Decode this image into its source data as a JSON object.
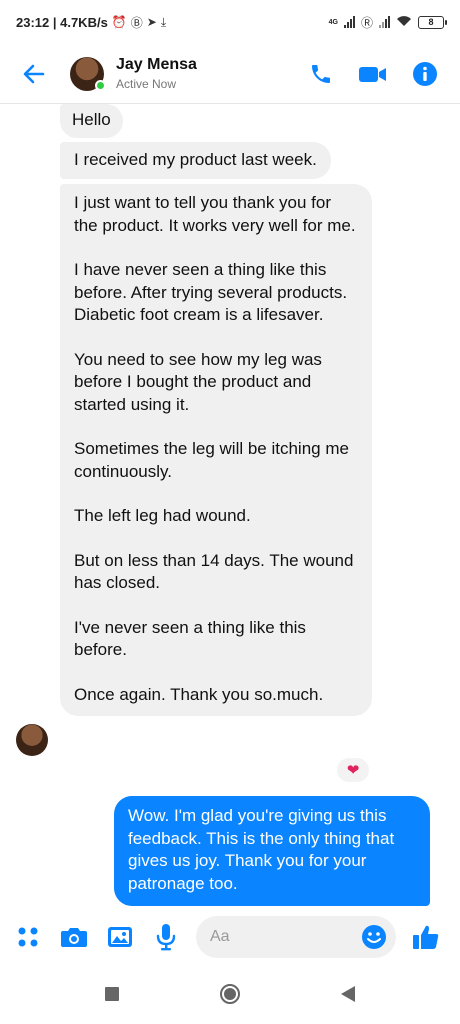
{
  "status": {
    "time_speed": "23:12 | 4.7KB/s",
    "net_label": "4G",
    "battery": "8"
  },
  "header": {
    "name": "Jay Mensa",
    "status": "Active Now"
  },
  "messages": {
    "hello": "Hello",
    "received": "I received my product last week.",
    "long": [
      "I just want to tell you thank you for the product. It works very well for me.",
      "I have never seen a thing like this before. After trying several products. Diabetic foot cream is a lifesaver.",
      "You need to see how my leg was before I bought the product and started using it.",
      "Sometimes the leg will be itching me continuously.",
      "The left leg had wound.",
      "But on less than 14 days. The wound has closed.",
      "I've never seen a thing like this before.",
      "Once again. Thank you so.much."
    ],
    "reaction": "❤",
    "sent": "Wow. I'm glad you're giving us this feedback. This is the only thing that gives us joy. Thank you for your patronage too."
  },
  "composer": {
    "placeholder": "Aa"
  },
  "colors": {
    "accent": "#0a84ff",
    "incoming_bubble": "#f0f0f0",
    "online": "#31cc46"
  },
  "icons": {
    "back": "arrow-left-icon",
    "call": "phone-icon",
    "video": "video-camera-icon",
    "info": "info-icon",
    "menu": "four-dots-icon",
    "camera": "camera-icon",
    "gallery": "image-icon",
    "mic": "microphone-icon",
    "emoji": "smiley-icon",
    "like": "thumbs-up-icon"
  }
}
